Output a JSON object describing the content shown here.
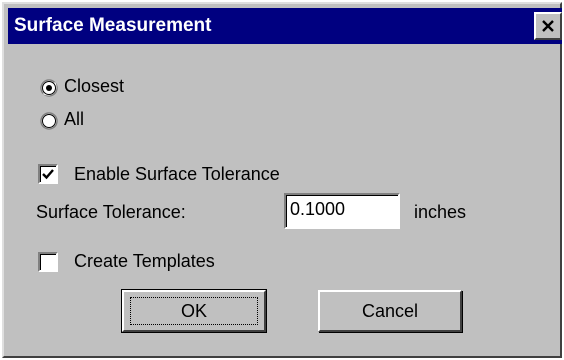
{
  "window": {
    "title": "Surface Measurement",
    "close_icon": "close-x-icon"
  },
  "radios": {
    "selected": "closest",
    "closest_label": "Closest",
    "all_label": "All"
  },
  "checkboxes": {
    "enable_tolerance_label": "Enable Surface Tolerance",
    "enable_tolerance_checked": true,
    "create_templates_label": "Create Templates",
    "create_templates_checked": false
  },
  "tolerance": {
    "label": "Surface Tolerance:",
    "value": "0.1000",
    "unit": "inches"
  },
  "buttons": {
    "ok_label": "OK",
    "cancel_label": "Cancel"
  },
  "colors": {
    "titlebar": "#000080",
    "face": "#c0c0c0"
  }
}
